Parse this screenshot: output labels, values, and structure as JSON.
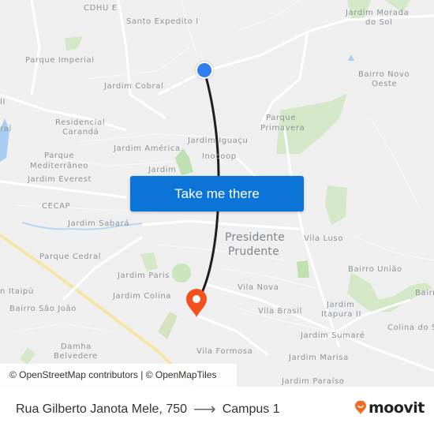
{
  "map": {
    "labels": {
      "cdhu_e": "CDHU E",
      "santo_expedito": "Santo Expedito I",
      "jardim_morada_1": "Jardim Morada",
      "jardim_morada_2": "do Sol",
      "parque_imperial": "Parque Imperial",
      "bairro_novo_1": "Bairro Novo",
      "bairro_novo_2": "Oeste",
      "jardim_cobral": "Jardim Cobral",
      "edge_ii": "II",
      "parque_primavera_1": "Parque",
      "parque_primavera_2": "Primavera",
      "residencial_1": "Residencial",
      "residencial_2": "Carandá",
      "edge_ral": "ral",
      "jardim_iguacu": "Jardim Iguaçu",
      "jardim_america": "Jardim América",
      "inocoop": "Inocoop",
      "parque_med_1": "Parque",
      "parque_med_2": "Mediterrâneo",
      "jardim_partial": "Jardim",
      "jardim_everest": "Jardim Everest",
      "cecap": "CECAP",
      "jardim_sabara": "Jardim Sabará",
      "presidente_1": "Presidente",
      "presidente_2": "Prudente",
      "vila_luso": "Vila Luso",
      "parque_cedral": "Parque Cedral",
      "bairro_uniao": "Bairro União",
      "jardim_paris": "Jardim Paris",
      "itaipu": "n Itaipú",
      "vila_nova": "Vila Nova",
      "bairro_edge": "Bairr",
      "jardim_colina": "Jardim Colina",
      "jardim_itapura_1": "Jardim",
      "jardim_itapura_2": "Itapura II",
      "bairro_sao_joao": "Bairro São João",
      "vila_brasil": "Vila Brasil",
      "colina_do_sol": "Colina do S",
      "jardim_sumare": "Jardim Sumaré",
      "damha_1": "Damha",
      "damha_2": "Belvedere",
      "vila_formosa": "Vila Formosa",
      "jardim_marisa": "Jardim Marisa",
      "jardim_paraiso": "Jardim Paraíso"
    },
    "cta_label": "Take me there",
    "attribution": "© OpenStreetMap contributors | © OpenMapTiles",
    "origin_marker_icon": "origin-dot-icon",
    "destination_marker_icon": "destination-pin-icon",
    "colors": {
      "route": "#1f1f1f",
      "origin": "#2f7ef0",
      "destination": "#f4501e",
      "cta": "#0b74d8",
      "park": "#cfe6c2",
      "highway": "#f6e6a6",
      "water": "#a9cdf0"
    }
  },
  "footer": {
    "origin": "Rua Gilberto Janota Mele, 750",
    "arrow": "⟶",
    "destination": "Campus 1",
    "brand": "moovit",
    "brand_color": "#f26b21"
  }
}
